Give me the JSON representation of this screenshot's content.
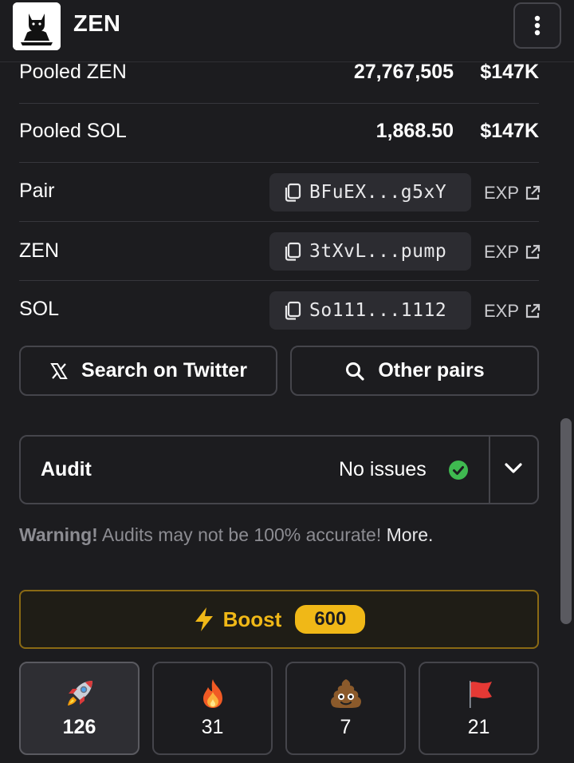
{
  "header": {
    "title": "ZEN",
    "logo_icon": "cat-meditation-logo",
    "menu_icon": "vertical-dots-icon"
  },
  "pooled": [
    {
      "label": "Pooled ZEN",
      "amount": "27,767,505",
      "usd": "$147K"
    },
    {
      "label": "Pooled SOL",
      "amount": "1,868.50",
      "usd": "$147K"
    }
  ],
  "addresses": [
    {
      "label": "Pair",
      "address": "BFuEX...g5xY",
      "exp": "EXP"
    },
    {
      "label": "ZEN",
      "address": "3tXvL...pump",
      "exp": "EXP"
    },
    {
      "label": "SOL",
      "address": "So111...1112",
      "exp": "EXP"
    }
  ],
  "actions": {
    "twitter_label": "Search on Twitter",
    "other_pairs_label": "Other pairs"
  },
  "audit": {
    "title": "Audit",
    "status": "No issues"
  },
  "warning": {
    "bold": "Warning!",
    "text": " Audits may not be 100% accurate! ",
    "more": "More."
  },
  "boost": {
    "label": "Boost",
    "count": "600"
  },
  "reactions": [
    {
      "icon": "rocket-icon",
      "count": "126",
      "active": true
    },
    {
      "icon": "fire-icon",
      "count": "31",
      "active": false
    },
    {
      "icon": "poop-icon",
      "count": "7",
      "active": false
    },
    {
      "icon": "red-flag-icon",
      "count": "21",
      "active": false
    }
  ],
  "colors": {
    "background": "#1c1c1f",
    "boost_accent": "#f0b817",
    "check_green": "#3fb950"
  }
}
